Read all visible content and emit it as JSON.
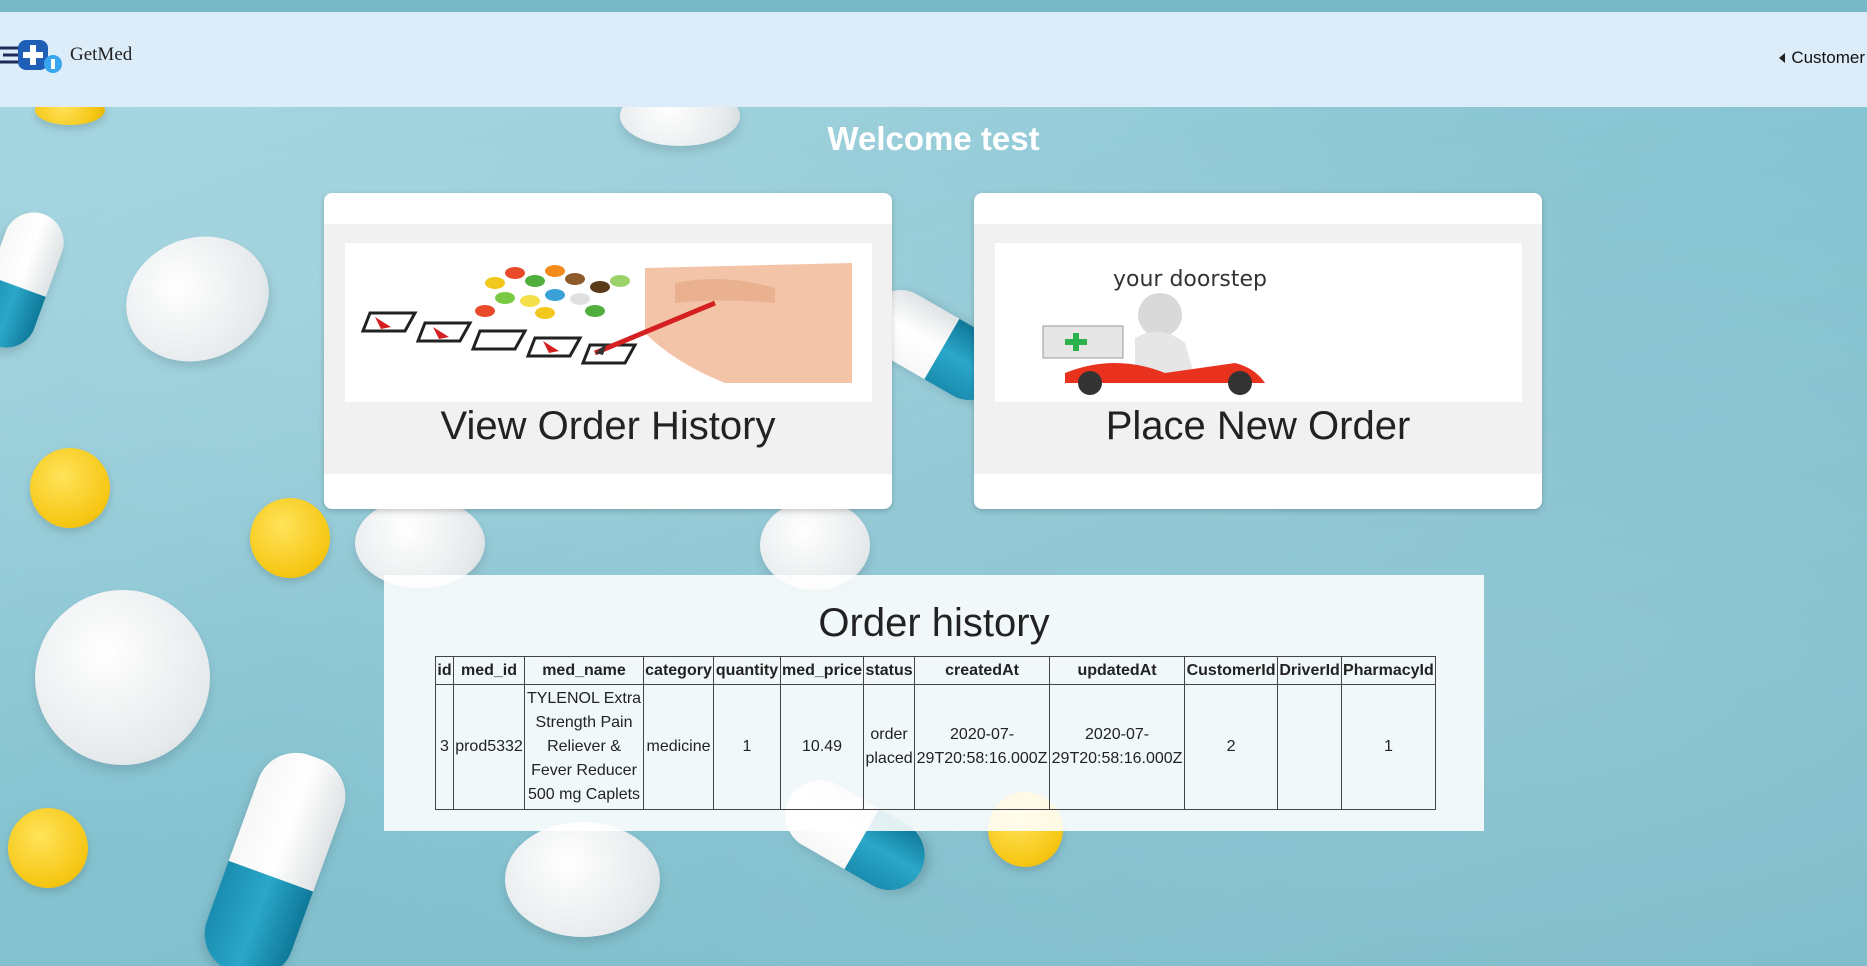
{
  "brand": {
    "name": "GetMed"
  },
  "nav": {
    "user_menu": "Customer"
  },
  "welcome": "Welcome test",
  "cards": [
    {
      "title": "View Order History",
      "image": "checklist-pills-image"
    },
    {
      "title": "Place New Order",
      "image": "delivery-scooter-image",
      "image_text": "your doorstep"
    }
  ],
  "orders": {
    "title": "Order history",
    "columns": [
      "id",
      "med_id",
      "med_name",
      "category",
      "quantity",
      "med_price",
      "status",
      "createdAt",
      "updatedAt",
      "CustomerId",
      "DriverId",
      "PharmacyId"
    ],
    "rows": [
      [
        "3",
        "prod5332",
        "TYLENOL Extra Strength Pain Reliever & Fever Reducer 500 mg Caplets",
        "medicine",
        "1",
        "10.49",
        "order placed",
        "2020-07-29T20:58:16.000Z",
        "2020-07-29T20:58:16.000Z",
        "2",
        "",
        "1"
      ]
    ]
  },
  "colors": {
    "navbar": "#dcedf9",
    "background": "#8ec9d6",
    "scooter": "#e8321e",
    "cross": "#2bb24c"
  }
}
